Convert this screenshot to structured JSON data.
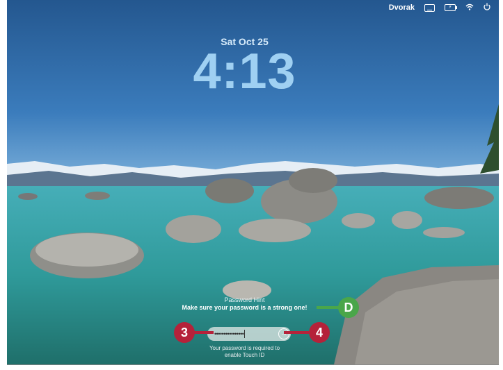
{
  "menubar": {
    "input_source": "Dvorak",
    "icons": [
      "keyboard-icon",
      "battery-icon",
      "wifi-icon",
      "power-icon"
    ]
  },
  "lockscreen": {
    "date": "Sat Oct 25",
    "time": "4:13",
    "hint_title": "Password Hint",
    "hint_text": "Make sure your password is a strong one!",
    "password_dots": "••••••••••••••••",
    "touchid_note_line1": "Your password is required to",
    "touchid_note_line2": "enable Touch ID"
  },
  "callouts": {
    "left": "3",
    "right": "4",
    "hint": "D"
  },
  "colors": {
    "callout_red": "#b5223a",
    "callout_green": "#4aa64a",
    "sky": "#2f6fae",
    "water": "#3fa9a8"
  }
}
